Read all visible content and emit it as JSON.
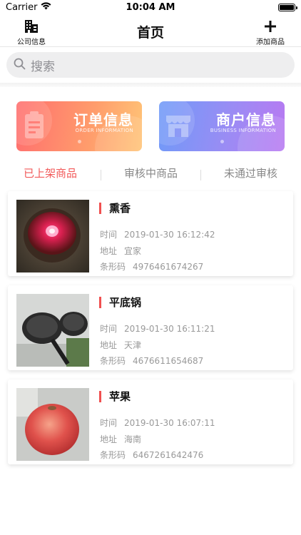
{
  "status_bar": {
    "carrier": "Carrier",
    "time": "10:04 AM"
  },
  "nav": {
    "title": "首页",
    "left_label": "公司信息",
    "left_icon": "building-icon",
    "right_label": "添加商品",
    "right_icon": "plus-icon"
  },
  "search": {
    "placeholder": "搜索"
  },
  "banners": [
    {
      "title": "订单信息",
      "subtitle": "ORDER INFORMATION",
      "icon": "clipboard-icon"
    },
    {
      "title": "商户信息",
      "subtitle": "BUSINESS INFORMATION",
      "icon": "store-icon"
    }
  ],
  "tabs": [
    {
      "label": "已上架商品",
      "active": true
    },
    {
      "label": "审核中商品",
      "active": false
    },
    {
      "label": "未通过审核",
      "active": false
    }
  ],
  "field_labels": {
    "time": "时间",
    "address": "地址",
    "barcode": "条形码"
  },
  "products": [
    {
      "name": "熏香",
      "time": "2019-01-30 16:12:42",
      "address": "宜家",
      "barcode": "4976461674267"
    },
    {
      "name": "平底锅",
      "time": "2019-01-30 16:11:21",
      "address": "天津",
      "barcode": "4676611654687"
    },
    {
      "name": "苹果",
      "time": "2019-01-30 16:07:11",
      "address": "海南",
      "barcode": "6467261642476"
    }
  ],
  "colors": {
    "accent": "#f25a5a",
    "order_gradient": "#ff6e6e",
    "business_gradient": "#6f9af8"
  }
}
